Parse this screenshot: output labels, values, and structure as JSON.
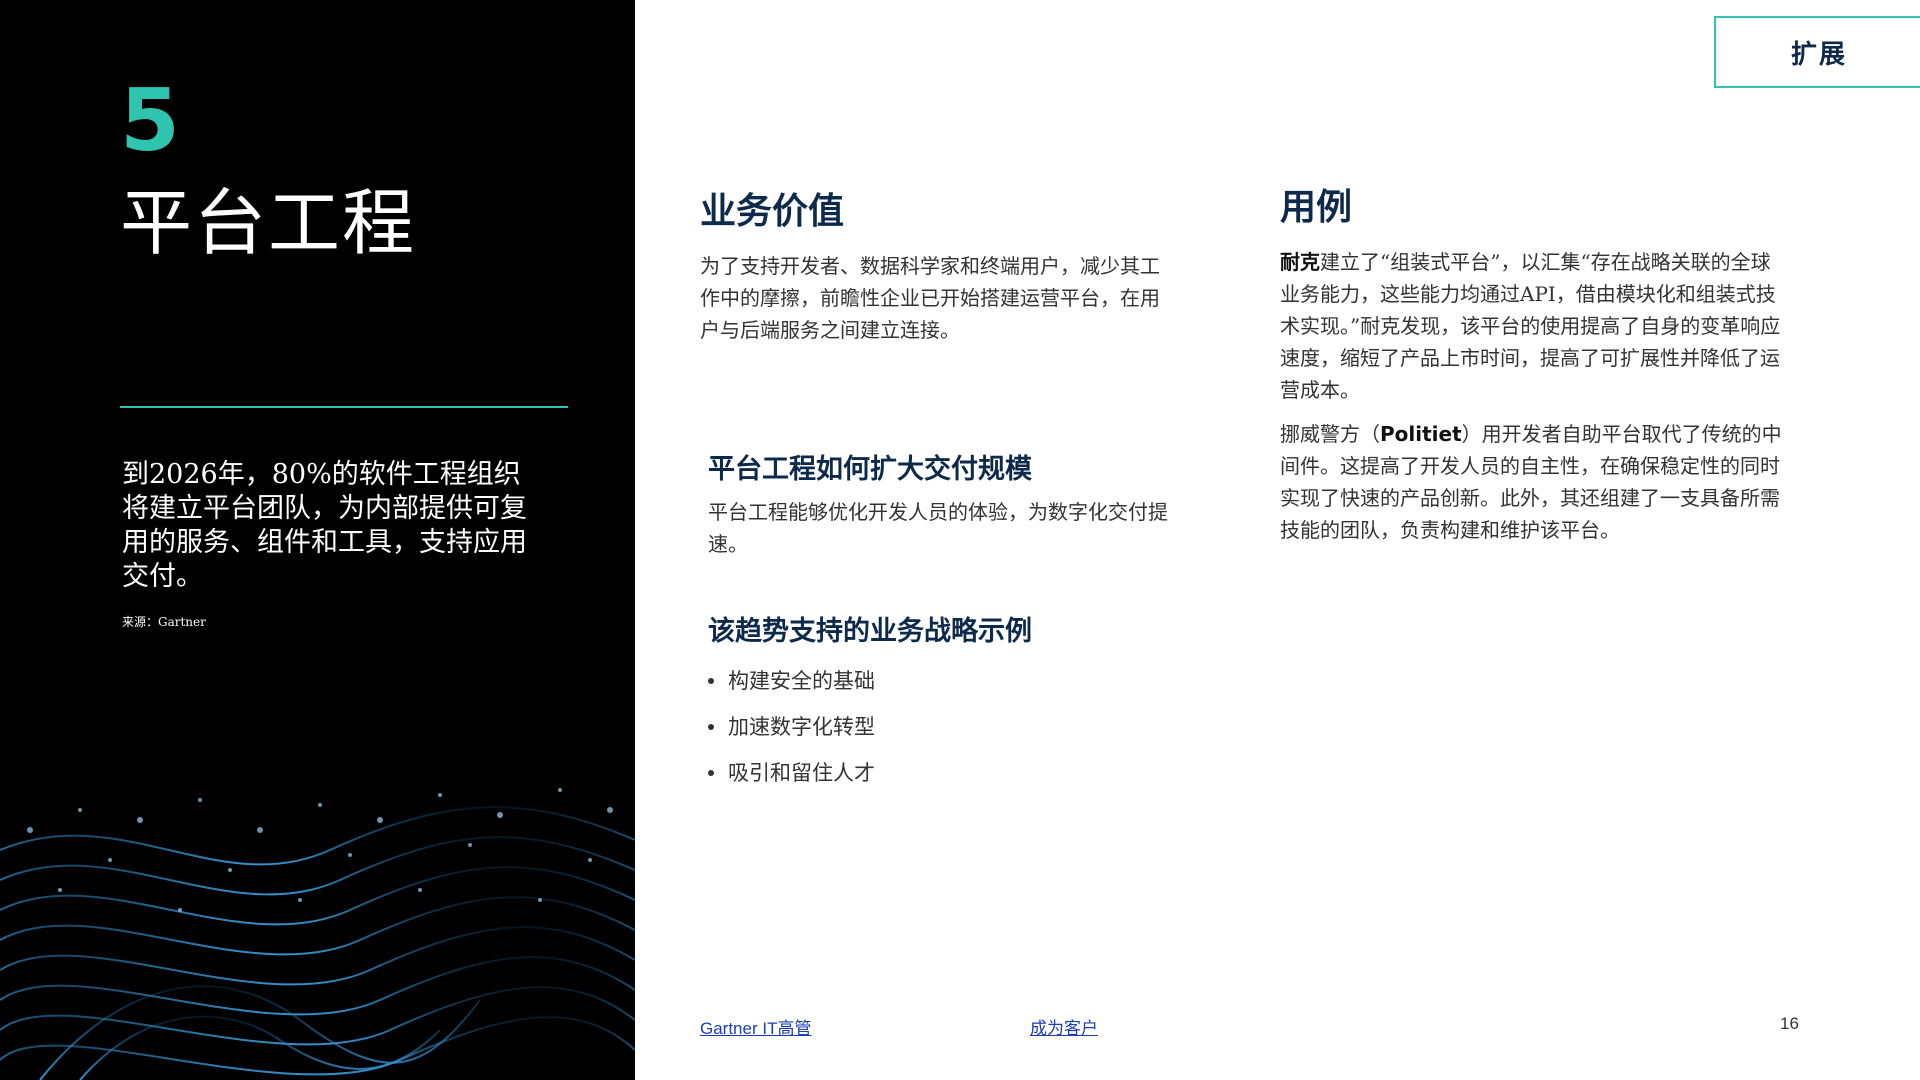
{
  "left_panel": {
    "trend_number": "5",
    "trend_title": "平台工程",
    "prediction": "到2026年，80%的软件工程组织将建立平台团队，为内部提供可复用的服务、组件和工具，支持应用交付。",
    "source": "来源：Gartner"
  },
  "extend_button": {
    "label": "扩展"
  },
  "business_value": {
    "heading": "业务价值",
    "text": "为了支持开发者、数据科学家和终端用户，减少其工作中的摩擦，前瞻性企业已开始搭建运营平台，在用户与后端服务之间建立连接。"
  },
  "scale_delivery": {
    "heading": "平台工程如何扩大交付规模",
    "text": "平台工程能够优化开发人员的体验，为数字化交付提速。"
  },
  "strategy": {
    "heading": "该趋势支持的业务战略示例",
    "items": [
      "构建安全的基础",
      "加速数字化转型",
      "吸引和留住人才"
    ]
  },
  "use_cases": {
    "heading": "用例",
    "case1_bold": "耐克",
    "case1_text": "建立了“组装式平台”，以汇集“存在战略关联的全球业务能力，这些能力均通过API，借由模块化和组装式技术实现。”耐克发现，该平台的使用提高了自身的变革响应速度，缩短了产品上市时间，提高了可扩展性并降低了运营成本。",
    "case2_prefix": "挪威警方（",
    "case2_bold": "Politiet",
    "case2_text": "）用开发者自助平台取代了传统的中间件。这提高了开发人员的自主性，在确保稳定性的同时实现了快速的产品创新。此外，其还组建了一支具备所需技能的团队，负责构建和维护该平台。"
  },
  "footer": {
    "link1": "Gartner IT高管",
    "link2": "成为客户",
    "page_number": "16"
  },
  "colors": {
    "accent": "#2ec4b0",
    "heading": "#0d2a4c",
    "link": "#1a3fb5"
  }
}
